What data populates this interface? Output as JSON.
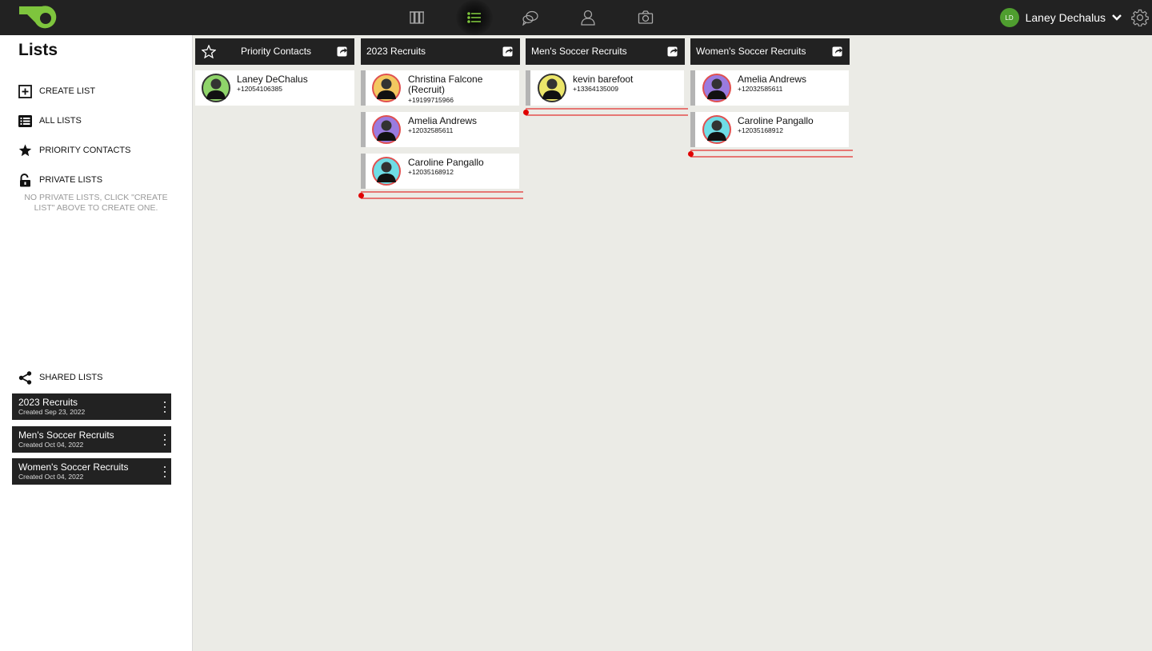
{
  "nav": {
    "items": [
      {
        "name": "columns",
        "active": false
      },
      {
        "name": "lists",
        "active": true
      },
      {
        "name": "chats",
        "active": false
      },
      {
        "name": "contacts",
        "active": false
      },
      {
        "name": "camera",
        "active": false
      }
    ],
    "user": {
      "initials": "LD",
      "name": "Laney Dechalus"
    },
    "accent": "#7ec53d"
  },
  "sidebar": {
    "title": "Lists",
    "create_label": "CREATE LIST",
    "all_label": "ALL LISTS",
    "priority_label": "PRIORITY CONTACTS",
    "private_label": "PRIVATE LISTS",
    "private_empty": "NO PRIVATE LISTS, CLICK \"CREATE LIST\" ABOVE TO CREATE ONE.",
    "shared_label": "SHARED LISTS",
    "shared_lists": [
      {
        "title": "2023 Recruits",
        "created": "Created Sep 23, 2022"
      },
      {
        "title": "Men's Soccer Recruits",
        "created": "Created Oct 04, 2022"
      },
      {
        "title": "Women's Soccer Recruits",
        "created": "Created Oct 04, 2022"
      }
    ]
  },
  "columns": [
    {
      "title": "Priority Contacts",
      "contacts": [
        {
          "name": "Laney DeChalus",
          "phone": "+12054106385",
          "avatar_color": "#8fd46a",
          "ring": "#333"
        }
      ]
    },
    {
      "title": "2023 Recruits",
      "contacts": [
        {
          "name": "Christina Falcone (Recruit)",
          "phone": "+19199715966",
          "avatar_color": "#f3c860",
          "ring": "#e05050"
        },
        {
          "name": "Amelia Andrews",
          "phone": "+12032585611",
          "avatar_color": "#9a7be0",
          "ring": "#e05050"
        },
        {
          "name": "Caroline Pangallo",
          "phone": "+12035168912",
          "avatar_color": "#6fdde6",
          "ring": "#e05050"
        }
      ]
    },
    {
      "title": "Men's Soccer Recruits",
      "contacts": [
        {
          "name": "kevin barefoot",
          "phone": "+13364135009",
          "avatar_color": "#ece66a",
          "ring": "#333"
        }
      ]
    },
    {
      "title": "Women's Soccer Recruits",
      "contacts": [
        {
          "name": "Amelia Andrews",
          "phone": "+12032585611",
          "avatar_color": "#9a7be0",
          "ring": "#e05050"
        },
        {
          "name": "Caroline Pangallo",
          "phone": "+12035168912",
          "avatar_color": "#6fdde6",
          "ring": "#e05050"
        }
      ]
    }
  ]
}
